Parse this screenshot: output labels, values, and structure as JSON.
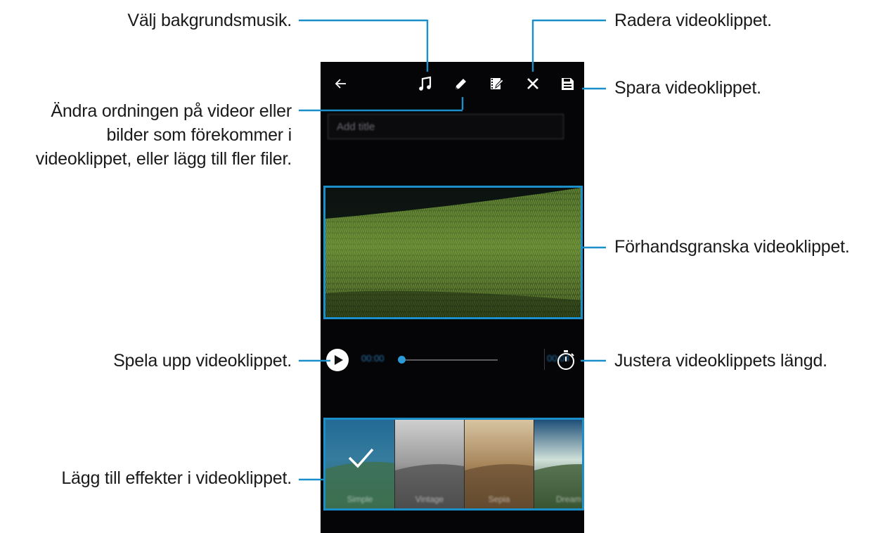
{
  "callouts": {
    "background_music": "Välj bakgrundsmusik.",
    "change_order": [
      "Ändra ordningen på videor eller",
      "bilder som förekommer i",
      "videoklippet, eller lägg till fler filer."
    ],
    "delete_clip": "Radera videoklippet.",
    "save_clip": "Spara videoklippet.",
    "preview_clip": "Förhandsgranska videoklippet.",
    "play_clip": "Spela upp videoklippet.",
    "adjust_length": "Justera videoklippets längd.",
    "add_effects": "Lägg till effekter i videoklippet."
  },
  "screen": {
    "toolbar_icons": [
      "back-arrow-icon",
      "music-note-icon",
      "pencil-icon",
      "edit-clip-icon",
      "close-icon",
      "save-icon"
    ],
    "title_placeholder": "Add title",
    "playback": {
      "start_time": "00:00",
      "end_time": "00:04",
      "progress": 0.0
    },
    "effects": [
      {
        "label": "Simple",
        "selected": true
      },
      {
        "label": "Vintage",
        "selected": false
      },
      {
        "label": "Sepia",
        "selected": false
      },
      {
        "label": "Dream",
        "selected": false
      }
    ]
  },
  "colors": {
    "accent": "#1a8fc9",
    "screen_bg": "#050507",
    "progress_thumb": "#2b9bd8"
  }
}
